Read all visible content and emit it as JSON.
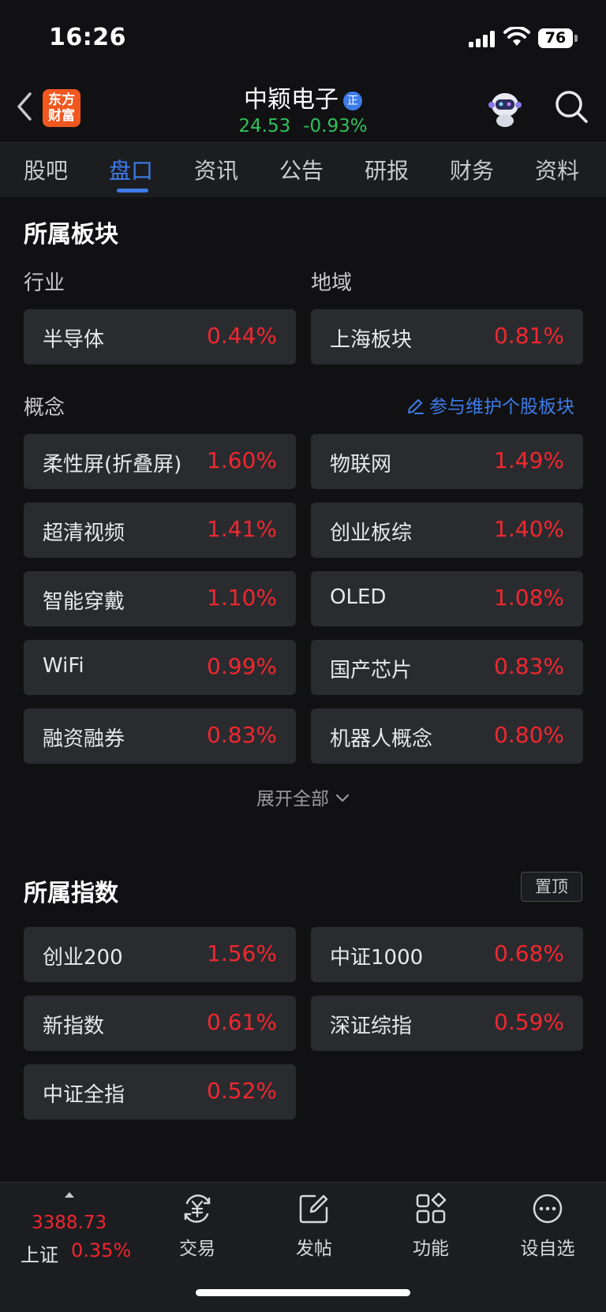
{
  "status_bar": {
    "time": "16:26",
    "battery": "76"
  },
  "header": {
    "logo_line1": "东方",
    "logo_line2": "财富",
    "stock_name": "中颖电子",
    "badge": "正",
    "price": "24.53",
    "change": "-0.93%"
  },
  "tabs": [
    {
      "label": "股吧"
    },
    {
      "label": "盘口"
    },
    {
      "label": "资讯"
    },
    {
      "label": "公告"
    },
    {
      "label": "研报"
    },
    {
      "label": "财务"
    },
    {
      "label": "资料"
    }
  ],
  "active_tab": "盘口",
  "sectors": {
    "title": "所属板块",
    "industry_label": "行业",
    "region_label": "地域",
    "industry": {
      "name": "半导体",
      "pct": "0.44%"
    },
    "region": {
      "name": "上海板块",
      "pct": "0.81%"
    },
    "concept_label": "概念",
    "maintain_link": "参与维护个股板块",
    "concepts": [
      {
        "name": "柔性屏(折叠屏)",
        "pct": "1.60%"
      },
      {
        "name": "物联网",
        "pct": "1.49%"
      },
      {
        "name": "超清视频",
        "pct": "1.41%"
      },
      {
        "name": "创业板综",
        "pct": "1.40%"
      },
      {
        "name": "智能穿戴",
        "pct": "1.10%"
      },
      {
        "name": "OLED",
        "pct": "1.08%"
      },
      {
        "name": "WiFi",
        "pct": "0.99%"
      },
      {
        "name": "国产芯片",
        "pct": "0.83%"
      },
      {
        "name": "融资融券",
        "pct": "0.83%"
      },
      {
        "name": "机器人概念",
        "pct": "0.80%"
      }
    ],
    "expand_label": "展开全部"
  },
  "indices": {
    "title": "所属指数",
    "pin_label": "置顶",
    "items": [
      {
        "name": "创业200",
        "pct": "1.56%"
      },
      {
        "name": "中证1000",
        "pct": "0.68%"
      },
      {
        "name": "新指数",
        "pct": "0.61%"
      },
      {
        "name": "深证综指",
        "pct": "0.59%"
      },
      {
        "name": "中证全指",
        "pct": "0.52%"
      }
    ]
  },
  "bottom_bar": {
    "index_value": "3388.73",
    "index_name": "上证",
    "index_change": "0.35%",
    "nav": [
      {
        "label": "交易",
        "icon": "yuan-exchange-icon"
      },
      {
        "label": "发帖",
        "icon": "edit-post-icon"
      },
      {
        "label": "功能",
        "icon": "grid-functions-icon"
      },
      {
        "label": "设自选",
        "icon": "more-circle-icon"
      }
    ]
  },
  "colors": {
    "up": "#f0272f",
    "down": "#2fc25b",
    "accent": "#3d7ce8",
    "card": "#2a2b2f",
    "background": "#111113"
  }
}
